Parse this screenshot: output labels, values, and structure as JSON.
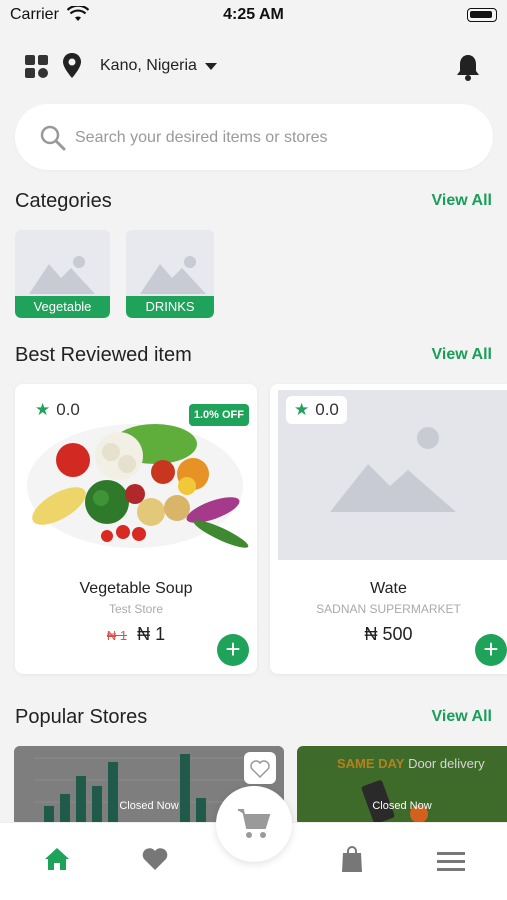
{
  "status": {
    "carrier": "Carrier",
    "time": "4:25 AM"
  },
  "header": {
    "location": "Kano, Nigeria"
  },
  "search": {
    "placeholder": "Search your desired items or stores"
  },
  "categories": {
    "title": "Categories",
    "view_all": "View All",
    "items": [
      {
        "label": "Vegetable"
      },
      {
        "label": "DRINKS"
      }
    ]
  },
  "best_reviewed": {
    "title": "Best Reviewed item",
    "view_all": "View All",
    "items": [
      {
        "rating": "0.0",
        "discount": "1.0% OFF",
        "name": "Vegetable Soup",
        "store": "Test Store",
        "old_price": "₦ 1",
        "price": "₦ 1"
      },
      {
        "rating": "0.0",
        "name": "Wate",
        "store": "SADNAN SUPERMARKET",
        "price": "₦ 500"
      }
    ]
  },
  "popular_stores": {
    "title": "Popular Stores",
    "view_all": "View All",
    "items": [
      {
        "status": "Closed Now"
      },
      {
        "status": "Closed Now",
        "banner_text": "Door delivery",
        "banner_highlight": "SAME DAY"
      }
    ]
  },
  "colors": {
    "accent": "#1fa35b"
  }
}
